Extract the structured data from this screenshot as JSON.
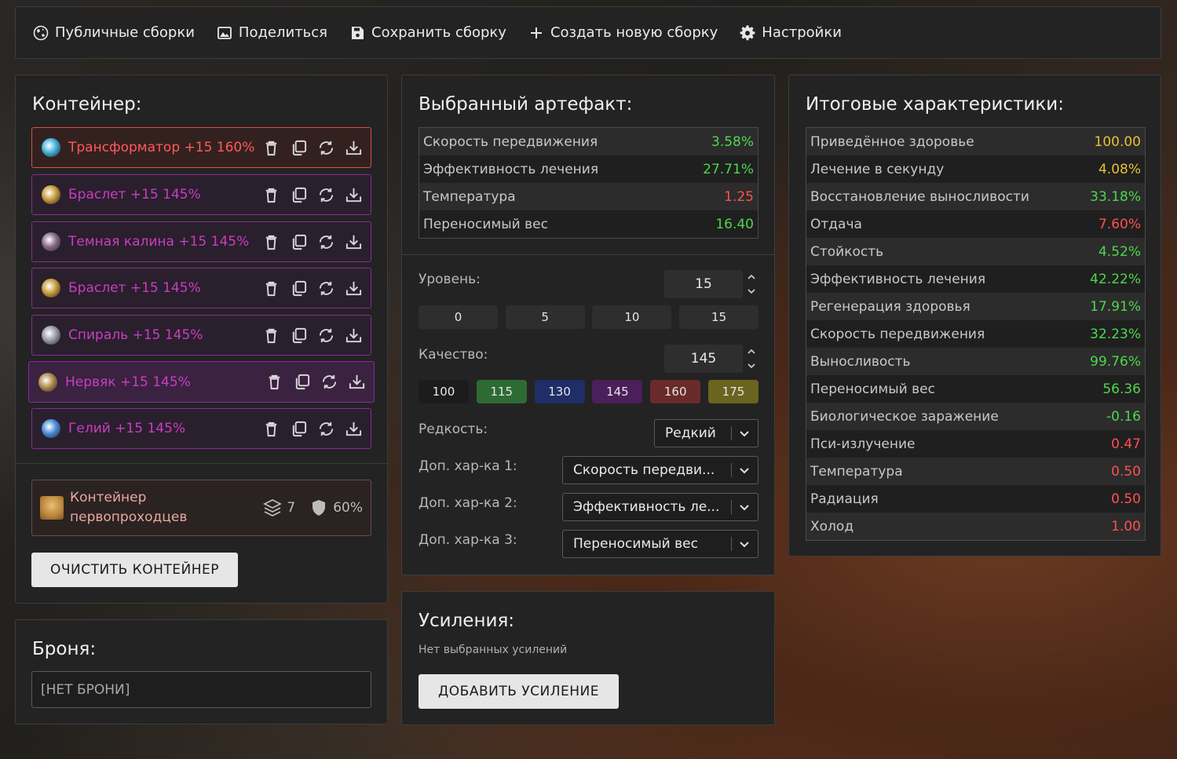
{
  "toolbar": {
    "public_builds": "Публичные сборки",
    "share": "Поделиться",
    "save_build": "Сохранить сборку",
    "new_build": "Создать новую сборку",
    "settings": "Настройки"
  },
  "container": {
    "title": "Контейнер:",
    "artifacts": [
      {
        "name": "Трансформатор +15 160%",
        "icon_color": "#3fb0d8"
      },
      {
        "name": "Браслет +15 145%",
        "icon_color": "#c89a3a"
      },
      {
        "name": "Темная калина +15 145%",
        "icon_color": "#8a6a8a"
      },
      {
        "name": "Браслет +15 145%",
        "icon_color": "#c89a3a"
      },
      {
        "name": "Спираль +15 145%",
        "icon_color": "#9a9aa8"
      },
      {
        "name": "Нервяк +15 145%",
        "icon_color": "#b08a4a"
      },
      {
        "name": "Гелий +15 145%",
        "icon_color": "#4a8ad8"
      }
    ],
    "card": {
      "name": "Контейнер первопроходцев",
      "slots": "7",
      "protection": "60%"
    },
    "clear_button": "ОЧИСТИТЬ КОНТЕЙНЕР"
  },
  "armor": {
    "title": "Броня:",
    "value": "[НЕТ БРОНИ]"
  },
  "artifact": {
    "title": "Выбранный артефакт:",
    "stats": [
      {
        "label": "Скорость передвижения",
        "value": "3.58%",
        "tone": "pos"
      },
      {
        "label": "Эффективность лечения",
        "value": "27.71%",
        "tone": "pos"
      },
      {
        "label": "Температура",
        "value": "1.25",
        "tone": "neg"
      },
      {
        "label": "Переносимый вес",
        "value": "16.40",
        "tone": "pos"
      }
    ],
    "level_label": "Уровень:",
    "level_value": "15",
    "level_presets": [
      "0",
      "5",
      "10",
      "15"
    ],
    "quality_label": "Качество:",
    "quality_value": "145",
    "quality_presets": [
      {
        "label": "100",
        "color": "#1c1c1c"
      },
      {
        "label": "115",
        "color": "#2e6a34"
      },
      {
        "label": "130",
        "color": "#1f2e66"
      },
      {
        "label": "145",
        "color": "#4a1f5a"
      },
      {
        "label": "160",
        "color": "#6a2a2a"
      },
      {
        "label": "175",
        "color": "#6a6420"
      }
    ],
    "rarity_label": "Редкость:",
    "rarity_value": "Редкий",
    "extra1_label": "Доп. хар-ка 1:",
    "extra1_value": "Скорость передви...",
    "extra2_label": "Доп. хар-ка 2:",
    "extra2_value": "Эффективность ле...",
    "extra3_label": "Доп. хар-ка 3:",
    "extra3_value": "Переносимый вес"
  },
  "boosts": {
    "title": "Усиления:",
    "empty": "Нет выбранных усилений",
    "add_button": "ДОБАВИТЬ УСИЛЕНИЕ"
  },
  "totals": {
    "title": "Итоговые характеристики:",
    "stats": [
      {
        "label": "Приведённое здоровье",
        "value": "100.00",
        "tone": "neu"
      },
      {
        "label": "Лечение в секунду",
        "value": "4.08%",
        "tone": "neu"
      },
      {
        "label": "Восстановление выносливости",
        "value": "33.18%",
        "tone": "pos"
      },
      {
        "label": "Отдача",
        "value": "7.60%",
        "tone": "neg"
      },
      {
        "label": "Стойкость",
        "value": "4.52%",
        "tone": "pos"
      },
      {
        "label": "Эффективность лечения",
        "value": "42.22%",
        "tone": "pos"
      },
      {
        "label": "Регенерация здоровья",
        "value": "17.91%",
        "tone": "pos"
      },
      {
        "label": "Скорость передвижения",
        "value": "32.23%",
        "tone": "pos"
      },
      {
        "label": "Выносливость",
        "value": "99.76%",
        "tone": "pos"
      },
      {
        "label": "Переносимый вес",
        "value": "56.36",
        "tone": "pos"
      },
      {
        "label": "Биологическое заражение",
        "value": "-0.16",
        "tone": "pos"
      },
      {
        "label": "Пси-излучение",
        "value": "0.47",
        "tone": "neg"
      },
      {
        "label": "Температура",
        "value": "0.50",
        "tone": "neg"
      },
      {
        "label": "Радиация",
        "value": "0.50",
        "tone": "neg"
      },
      {
        "label": "Холод",
        "value": "1.00",
        "tone": "neg"
      }
    ]
  }
}
